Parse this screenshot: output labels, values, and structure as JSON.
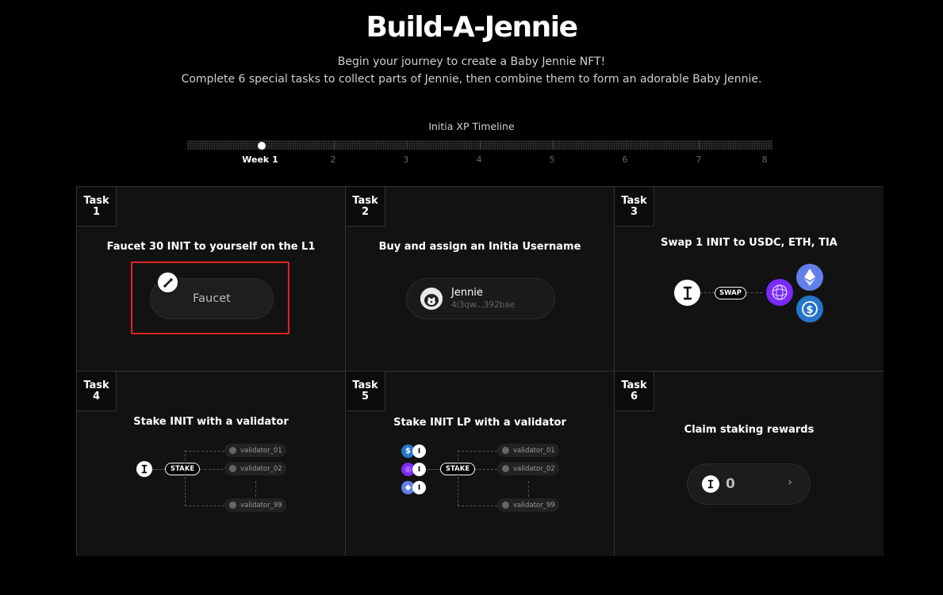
{
  "header": {
    "title": "Build-A-Jennie",
    "subtitle_line1": "Begin your journey to create a Baby Jennie NFT!",
    "subtitle_line2": "Complete 6 special tasks to collect parts of Jennie, then combine them to form an adorable Baby Jennie."
  },
  "timeline": {
    "label": "Initia XP Timeline",
    "current_week": 1,
    "weeks": [
      "Week 1",
      "2",
      "3",
      "4",
      "5",
      "6",
      "7",
      "8"
    ]
  },
  "tasks": [
    {
      "badge_word": "Task",
      "number": "1",
      "title": "Faucet 30 INIT to yourself on the L1",
      "button_label": "Faucet"
    },
    {
      "badge_word": "Task",
      "number": "2",
      "title": "Buy and assign an Initia Username",
      "username": "Jennie",
      "address": "4i3qw...392bae"
    },
    {
      "badge_word": "Task",
      "number": "3",
      "title": "Swap 1 INIT to USDC, ETH, TIA",
      "swap_label": "SWAP"
    },
    {
      "badge_word": "Task",
      "number": "4",
      "title": "Stake INIT with a validator",
      "stake_label": "STAKE",
      "validators": [
        "validator_01",
        "validator_02",
        "validator_99"
      ]
    },
    {
      "badge_word": "Task",
      "number": "5",
      "title": "Stake INIT LP with a validator",
      "stake_label": "STAKE",
      "validators": [
        "validator_01",
        "validator_02",
        "validator_99"
      ]
    },
    {
      "badge_word": "Task",
      "number": "6",
      "title": "Claim staking rewards",
      "reward_value": "0",
      "chevron": "›"
    }
  ],
  "colors": {
    "background": "#000000",
    "card": "#121212",
    "highlight": "#e52222",
    "usdc": "#2775ca",
    "eth": "#627eea",
    "tia": "#7b2bf9"
  },
  "icons": [
    "init-icon",
    "jennie-avatar-icon",
    "eth-icon",
    "usdc-icon",
    "tia-icon",
    "chevron-right-icon"
  ]
}
